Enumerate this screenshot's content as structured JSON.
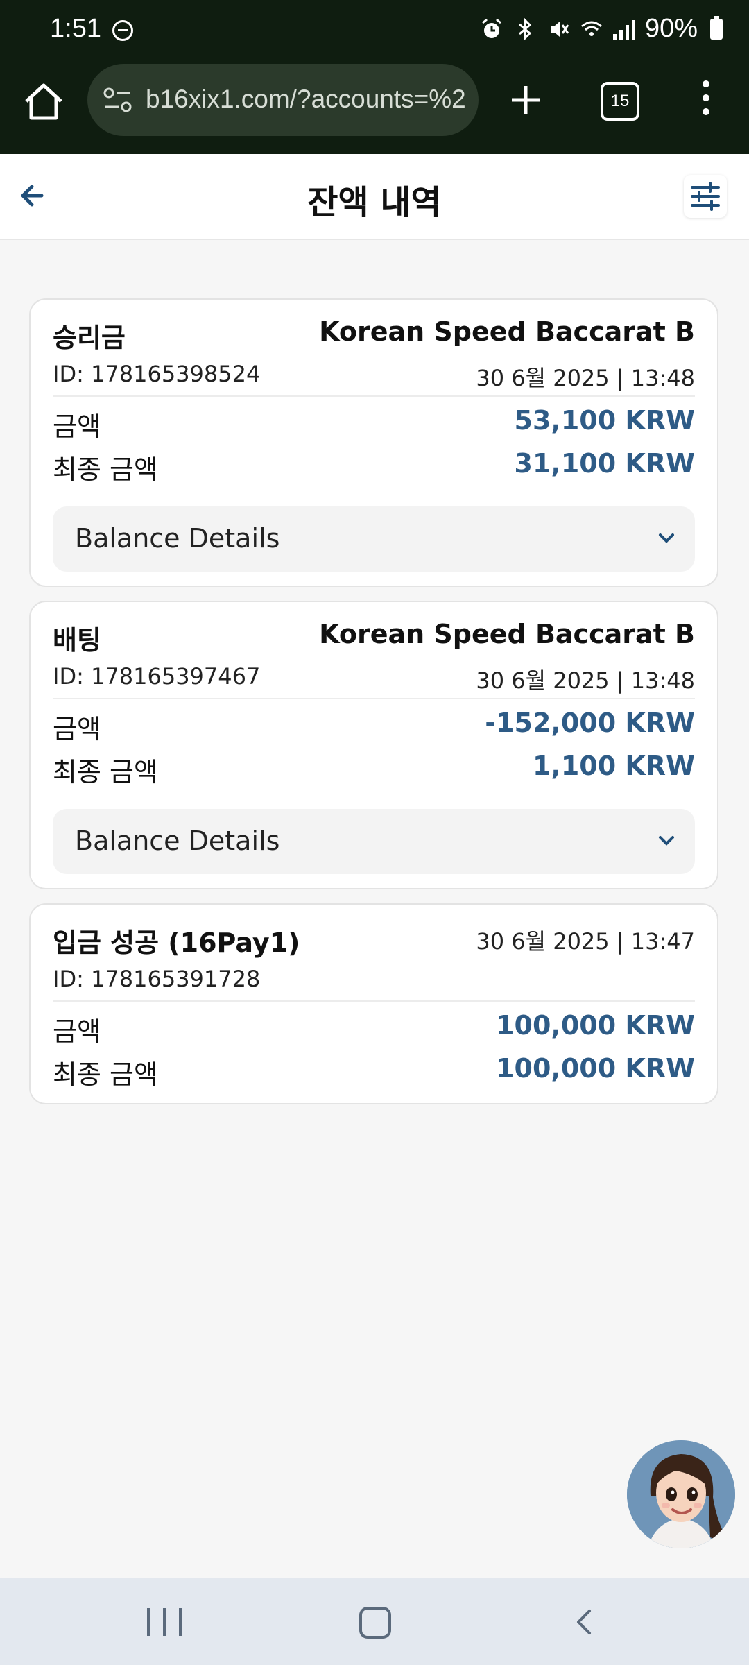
{
  "status_bar": {
    "time": "1:51",
    "battery": "90%"
  },
  "browser": {
    "url": "b16xix1.com/?accounts=%2",
    "tab_count": "15"
  },
  "header": {
    "title": "잔액 내역"
  },
  "transactions": [
    {
      "title": "승리금",
      "game": "Korean Speed Baccarat B",
      "id": "ID: 178165398524",
      "date": "30 6월 2025 | 13:48",
      "amount_label": "금액",
      "amount": "53,100 KRW",
      "final_label": "최종 금액",
      "final_amount": "31,100 KRW",
      "details_label": "Balance Details"
    },
    {
      "title": "배팅",
      "game": "Korean Speed Baccarat B",
      "id": "ID: 178165397467",
      "date": "30 6월 2025 | 13:48",
      "amount_label": "금액",
      "amount": "-152,000 KRW",
      "final_label": "최종 금액",
      "final_amount": "1,100 KRW",
      "details_label": "Balance Details"
    },
    {
      "title": "입금 성공 (16Pay1)",
      "id": "ID: 178165391728",
      "date": "30 6월 2025 | 13:47",
      "amount_label": "금액",
      "amount": "100,000 KRW",
      "final_label": "최종 금액",
      "final_amount": "100,000 KRW"
    }
  ],
  "colors": {
    "amount": "#2e5b86",
    "chrome": "#0f1d10",
    "accent": "#1f4e79"
  }
}
